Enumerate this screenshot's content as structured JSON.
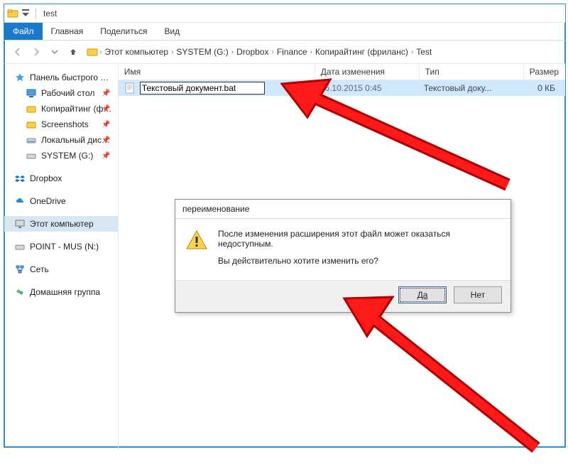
{
  "titlebar": {
    "title": "test"
  },
  "ribbon": {
    "file": "Файл",
    "tabs": [
      "Главная",
      "Поделиться",
      "Вид"
    ]
  },
  "breadcrumbs": [
    "Этот компьютер",
    "SYSTEM (G:)",
    "Dropbox",
    "Finance",
    "Копирайтинг (фриланс)",
    "Test"
  ],
  "sidebar": {
    "quick_access_label": "Панель быстрого доступа",
    "items": [
      {
        "label": "Рабочий стол",
        "pin": true,
        "icon": "desktop"
      },
      {
        "label": "Копирайтинг (фрилан",
        "pin": true,
        "icon": "folder"
      },
      {
        "label": "Screenshots",
        "pin": true,
        "icon": "folder"
      },
      {
        "label": "Локальный диск (C:)",
        "pin": true,
        "icon": "drive"
      },
      {
        "label": "SYSTEM (G:)",
        "pin": true,
        "icon": "drive"
      }
    ],
    "dropbox": "Dropbox",
    "onedrive": "OneDrive",
    "this_pc": "Этот компьютер",
    "point": "POINT - MUS (N:)",
    "network": "Сеть",
    "homegroup": "Домашняя группа"
  },
  "columns": {
    "name": "Имя",
    "date": "Дата изменения",
    "type": "Тип",
    "size": "Размер"
  },
  "files": [
    {
      "name": "Текстовый документ.bat",
      "date": "16.10.2015 0:45",
      "type": "Текстовый доку...",
      "size": "0 КБ"
    }
  ],
  "dialog": {
    "title": "переименование",
    "line1": "После изменения расширения этот файл может оказаться недоступным.",
    "line2": "Вы действительно хотите изменить его?",
    "yes": "Да",
    "no": "Нет"
  }
}
